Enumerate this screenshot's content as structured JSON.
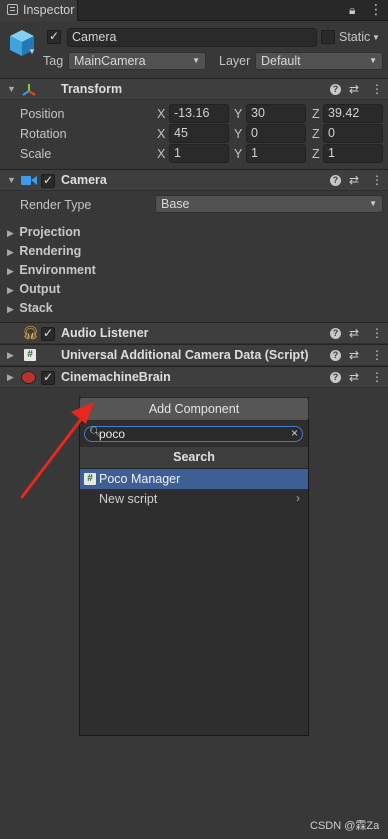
{
  "tab": {
    "label": "Inspector"
  },
  "header": {
    "name": "Camera",
    "static_label": "Static",
    "tag_label": "Tag",
    "tag_value": "MainCamera",
    "layer_label": "Layer",
    "layer_value": "Default"
  },
  "transform": {
    "title": "Transform",
    "rows": [
      {
        "label": "Position",
        "x": "-13.16",
        "y": "30",
        "z": "39.42"
      },
      {
        "label": "Rotation",
        "x": "45",
        "y": "0",
        "z": "0"
      },
      {
        "label": "Scale",
        "x": "1",
        "y": "1",
        "z": "1"
      }
    ],
    "axes": [
      "X",
      "Y",
      "Z"
    ]
  },
  "camera": {
    "title": "Camera",
    "render_type_label": "Render Type",
    "render_type_value": "Base",
    "sections": [
      "Projection",
      "Rendering",
      "Environment",
      "Output",
      "Stack"
    ]
  },
  "components": [
    {
      "title": "Audio Listener"
    },
    {
      "title": "Universal Additional Camera Data (Script)"
    },
    {
      "title": "CinemachineBrain"
    }
  ],
  "add_component": {
    "button_label": "Add Component",
    "search_value": "poco",
    "search_header": "Search",
    "results": [
      {
        "label": "Poco Manager",
        "selected": true
      },
      {
        "label": "New script",
        "selected": false
      }
    ]
  },
  "watermark": "CSDN @霖Za",
  "colors": {
    "selection": "#3e5f96",
    "annotation_arrow": "#e8281e",
    "background": "#383838"
  }
}
